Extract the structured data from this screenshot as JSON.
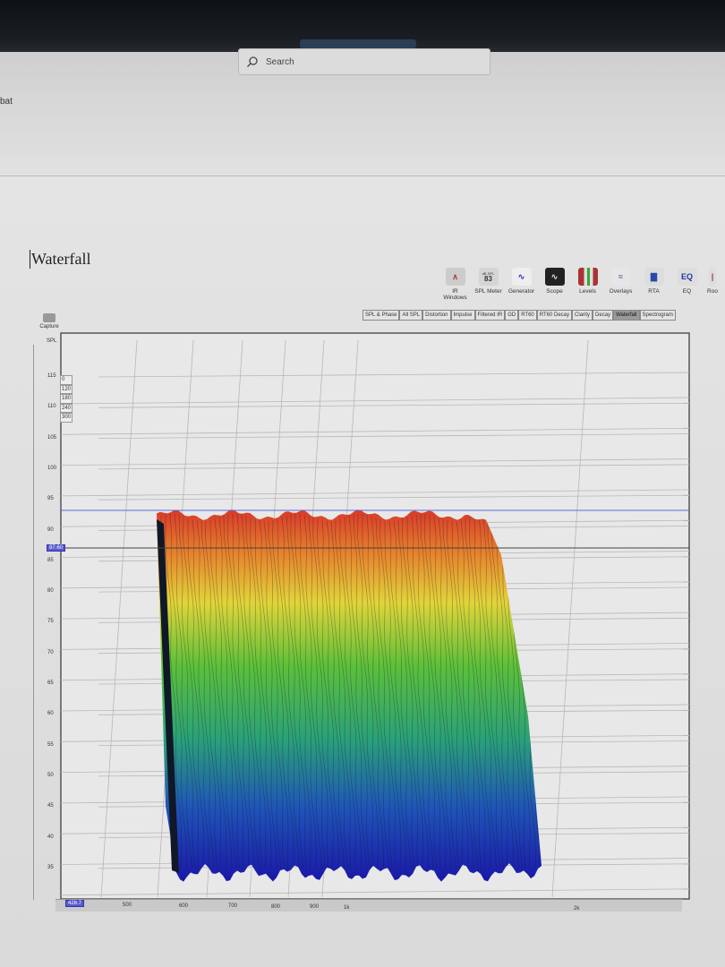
{
  "window": {
    "search_placeholder": "Search",
    "left_fragment": "bat"
  },
  "page": {
    "title": "Waterfall"
  },
  "toolbar": [
    {
      "label": "IR Windows",
      "icon": "ir-windows-icon"
    },
    {
      "label": "SPL Meter",
      "icon": "spl-meter-icon",
      "badge_top": "dB SPL",
      "badge_value": "83"
    },
    {
      "label": "Generator",
      "icon": "generator-icon"
    },
    {
      "label": "Scope",
      "icon": "scope-icon"
    },
    {
      "label": "Levels",
      "icon": "levels-icon"
    },
    {
      "label": "Overlays",
      "icon": "overlays-icon"
    },
    {
      "label": "RTA",
      "icon": "rta-icon"
    },
    {
      "label": "EQ",
      "icon": "eq-icon",
      "glyph": "EQ"
    },
    {
      "label": "Roo",
      "icon": "room-sim-icon"
    }
  ],
  "tabs": [
    "SPL & Phase",
    "All SPL",
    "Distortion",
    "Impulse",
    "Filtered IR",
    "GD",
    "RT60",
    "RT60 Decay",
    "Clarity",
    "Decay",
    "Waterfall",
    "Spectrogram"
  ],
  "active_tab": "Waterfall",
  "capture_label": "Capture",
  "graph": {
    "y_axis_label": "SPL",
    "y_ticks": [
      "115",
      "110",
      "105",
      "100",
      "95",
      "90",
      "85",
      "80",
      "75",
      "70",
      "65",
      "60",
      "55",
      "50",
      "45",
      "40",
      "35"
    ],
    "x_ticks": [
      "500",
      "600",
      "700",
      "800",
      "900",
      "1k",
      "2k"
    ],
    "legend_times": [
      "0",
      "120",
      "180",
      "240",
      "300"
    ],
    "cursor_y": "87.60",
    "cursor_x": "428.7",
    "colors": {
      "top": "#d8392a",
      "mid": "#3cb83a",
      "bottom": "#1a20b0",
      "cursor_line": "#5a6bd8"
    }
  }
}
